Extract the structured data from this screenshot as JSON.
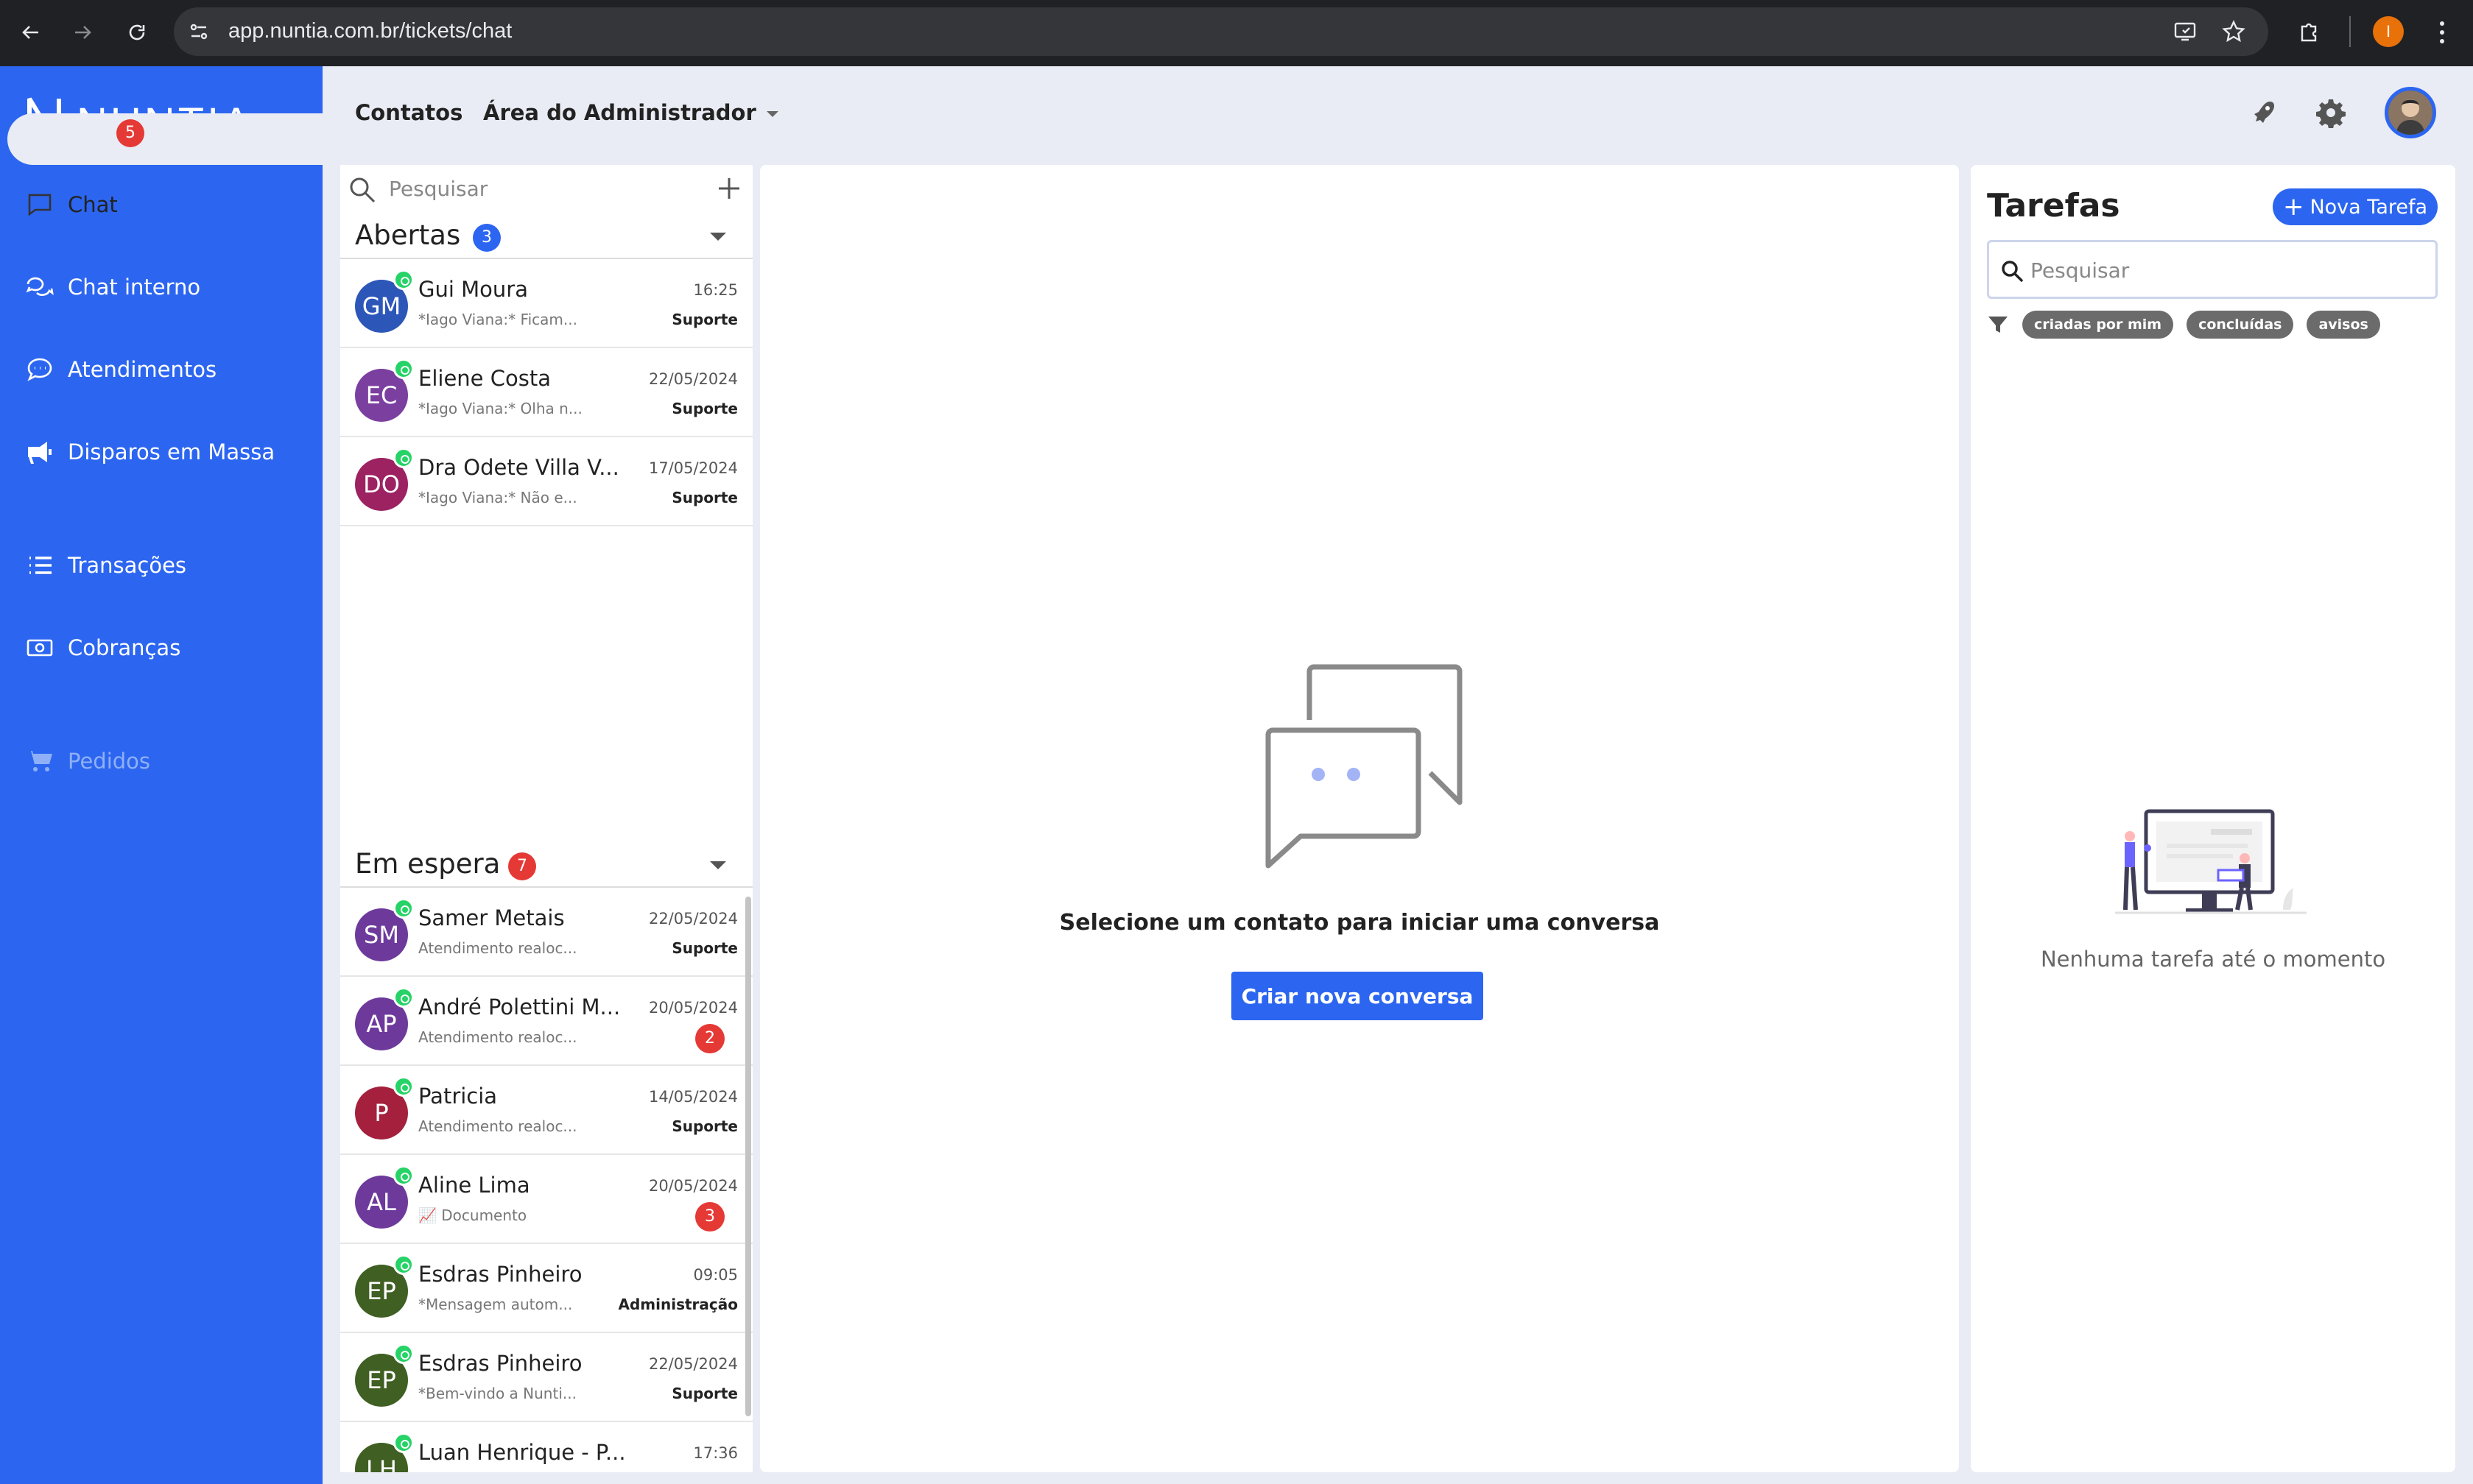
{
  "browser": {
    "url": "app.nuntia.com.br/tickets/chat",
    "profile_initial": "I"
  },
  "brand": {
    "name": "NUNTIA",
    "accent": "#2c66f0"
  },
  "sidebar": {
    "items": [
      {
        "label": "Chat",
        "icon": "chat-bubble-icon",
        "badge": "5",
        "active": true
      },
      {
        "label": "Chat interno",
        "icon": "chats-icon"
      },
      {
        "label": "Atendimentos",
        "icon": "speech-dots-icon"
      },
      {
        "label": "Disparos em Massa",
        "icon": "megaphone-icon"
      },
      {
        "label": "Transações",
        "icon": "list-icon"
      },
      {
        "label": "Cobranças",
        "icon": "money-bill-icon"
      },
      {
        "label": "Pedidos",
        "icon": "cart-icon",
        "disabled": true
      }
    ]
  },
  "header": {
    "contacts": "Contatos",
    "admin": "Área do Administrador",
    "icons": [
      "rocket-icon",
      "gear-icon",
      "user-avatar"
    ]
  },
  "tickets": {
    "search_placeholder": "Pesquisar",
    "open": {
      "title": "Abertas",
      "count": "3",
      "items": [
        {
          "initials": "GM",
          "color": "#2c56b8",
          "name": "Gui Moura",
          "message": "*Iago Viana:* Ficam...",
          "time": "16:25",
          "queue": "Suporte"
        },
        {
          "initials": "EC",
          "color": "#7b3fa0",
          "name": "Eliene Costa",
          "message": "*Iago Viana:* Olha n...",
          "time": "22/05/2024",
          "queue": "Suporte"
        },
        {
          "initials": "DO",
          "color": "#9c2262",
          "name": "Dra Odete Villa V...",
          "message": "*Iago Viana:* Não e...",
          "time": "17/05/2024",
          "queue": "Suporte"
        }
      ]
    },
    "waiting": {
      "title": "Em espera",
      "count": "7",
      "items": [
        {
          "initials": "SM",
          "color": "#6d3a9c",
          "name": "Samer Metais",
          "message": "Atendimento realoc...",
          "time": "22/05/2024",
          "queue": "Suporte"
        },
        {
          "initials": "AP",
          "color": "#6d3a9c",
          "name": "André Polettini M...",
          "message": "Atendimento realoc...",
          "time": "20/05/2024",
          "unread": "2"
        },
        {
          "initials": "P",
          "color": "#a4203d",
          "name": "Patricia",
          "message": "Atendimento realoc...",
          "time": "14/05/2024",
          "queue": "Suporte"
        },
        {
          "initials": "AL",
          "color": "#6d3a9c",
          "name": "Aline Lima",
          "message": "📈 Documento",
          "time": "20/05/2024",
          "unread": "3"
        },
        {
          "initials": "EP",
          "color": "#3f5f23",
          "name": "Esdras Pinheiro",
          "message": "*Mensagem autom...",
          "time": "09:05",
          "queue": "Administração"
        },
        {
          "initials": "EP",
          "color": "#3f5f23",
          "name": "Esdras Pinheiro",
          "message": "*Bem-vindo a Nunti...",
          "time": "22/05/2024",
          "queue": "Suporte"
        },
        {
          "initials": "LH",
          "color": "#3f5f23",
          "name": "Luan Henrique - P...",
          "message": "",
          "time": "17:36",
          "queue": ""
        }
      ]
    }
  },
  "center": {
    "empty_message": "Selecione um contato para iniciar uma conversa",
    "new_chat_button": "Criar nova conversa"
  },
  "tasks": {
    "title": "Tarefas",
    "new_button": "Nova Tarefa",
    "search_placeholder": "Pesquisar",
    "filters": [
      "criadas por mim",
      "concluídas",
      "avisos"
    ],
    "empty_message": "Nenhuma tarefa até o momento"
  }
}
